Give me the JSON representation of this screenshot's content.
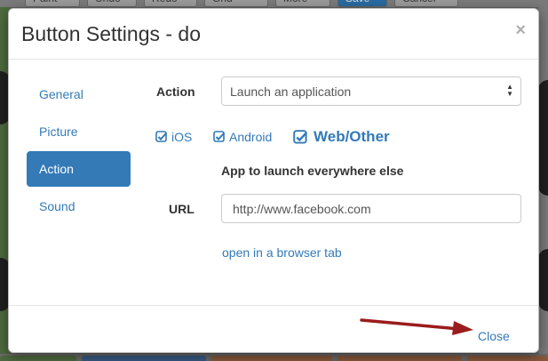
{
  "background": {
    "toolbar_buttons": [
      "Paint",
      "Undo",
      "Redo",
      "Grid",
      "More",
      "Save",
      "Cancel"
    ]
  },
  "modal": {
    "title": "Button Settings - do",
    "close_symbol": "×",
    "nav": [
      "General",
      "Picture",
      "Action",
      "Sound"
    ],
    "active_nav": "Action",
    "action_label": "Action",
    "action_value": "Launch an application",
    "platforms": [
      {
        "label": "iOS",
        "checked": true
      },
      {
        "label": "Android",
        "checked": true
      },
      {
        "label": "Web/Other",
        "checked": true,
        "selected": true
      }
    ],
    "section_heading": "App to launch everywhere else",
    "url_label": "URL",
    "url_value": "http://www.facebook.com",
    "open_link": "open in a browser tab",
    "footer_close": "Close"
  },
  "colors": {
    "accent": "#337ab7",
    "arrow": "#9b1c1c"
  }
}
